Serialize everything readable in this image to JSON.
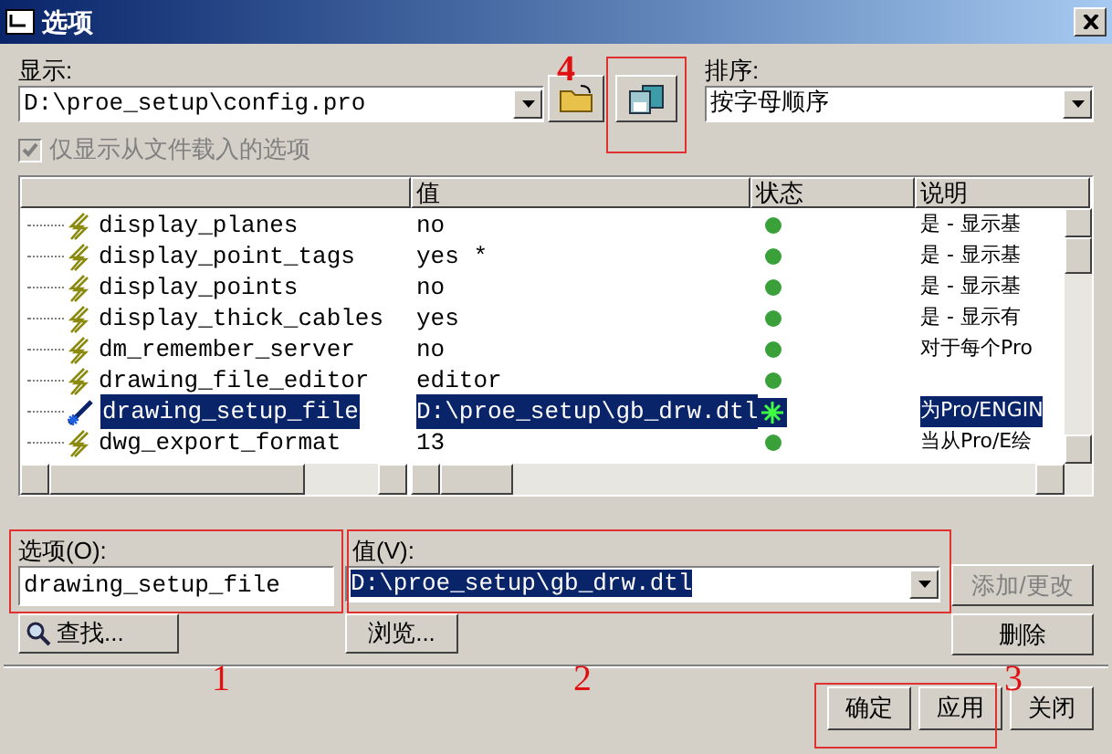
{
  "window": {
    "title": "选项"
  },
  "display": {
    "label": "显示:",
    "value": "D:\\proe_setup\\config.pro"
  },
  "sort": {
    "label": "排序:",
    "value": "按字母顺序"
  },
  "loaded_only": {
    "label": "仅显示从文件载入的选项",
    "checked": true,
    "disabled": true
  },
  "table": {
    "columns": [
      "值",
      "状态",
      "说明"
    ],
    "rows": [
      {
        "name": "display_planes",
        "value": "no",
        "modified": false,
        "description": "是 - 显示基",
        "selected": false
      },
      {
        "name": "display_point_tags",
        "value": "yes *",
        "modified": false,
        "description": "是 - 显示基",
        "selected": false
      },
      {
        "name": "display_points",
        "value": "no",
        "modified": false,
        "description": "是 - 显示基",
        "selected": false
      },
      {
        "name": "display_thick_cables",
        "value": "yes",
        "modified": false,
        "description": "是 - 显示有",
        "selected": false
      },
      {
        "name": "dm_remember_server",
        "value": "no",
        "modified": false,
        "description": "对于每个Pro",
        "selected": false
      },
      {
        "name": "drawing_file_editor",
        "value": "editor",
        "modified": false,
        "description": "",
        "selected": false
      },
      {
        "name": "drawing_setup_file",
        "value": "D:\\proe_setup\\gb_drw.dtl",
        "modified": true,
        "description": "为Pro/ENGIN",
        "selected": true
      },
      {
        "name": "dwg_export_format",
        "value": "13",
        "modified": false,
        "description": "当从Pro/E绘",
        "selected": false
      }
    ]
  },
  "option": {
    "label": "选项(O):",
    "value": "drawing_setup_file"
  },
  "find_button": "查找...",
  "value_field": {
    "label": "值(V):",
    "value": "D:\\proe_setup\\gb_drw.dtl"
  },
  "browse_button": "浏览...",
  "side_buttons": [
    {
      "label": "添加/更改",
      "disabled": true
    },
    {
      "label": "删除",
      "disabled": false
    }
  ],
  "footer_buttons": [
    "确定",
    "应用",
    "关闭"
  ],
  "annotations": [
    "4",
    "1",
    "2",
    "3"
  ]
}
